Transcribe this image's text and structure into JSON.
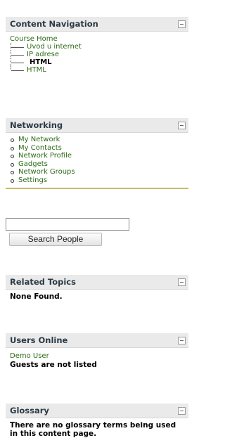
{
  "content_navigation": {
    "title": "Content Navigation",
    "root": "Course Home",
    "items": [
      "Uvod u internet",
      "IP adrese"
    ],
    "current": "HTML",
    "last_item": "HTML"
  },
  "networking": {
    "title": "Networking",
    "links": [
      "My Network",
      "My Contacts",
      "Network Profile",
      "Gadgets",
      "Network Groups",
      "Settings"
    ],
    "search_value": "",
    "search_button": "Search People"
  },
  "related_topics": {
    "title": "Related Topics",
    "message": "None Found."
  },
  "users_online": {
    "title": "Users Online",
    "user": "Demo User",
    "guests_message": "Guests are not listed"
  },
  "glossary": {
    "title": "Glossary",
    "message": "There are no glossary terms being used in this content page."
  },
  "colors": {
    "link": "#2d6b17",
    "header_bg": "#eaeaea",
    "divider": "#c8b96a"
  },
  "icons": {
    "collapse": "minus-box-icon",
    "bullet": "open-circle-bullet-icon"
  }
}
